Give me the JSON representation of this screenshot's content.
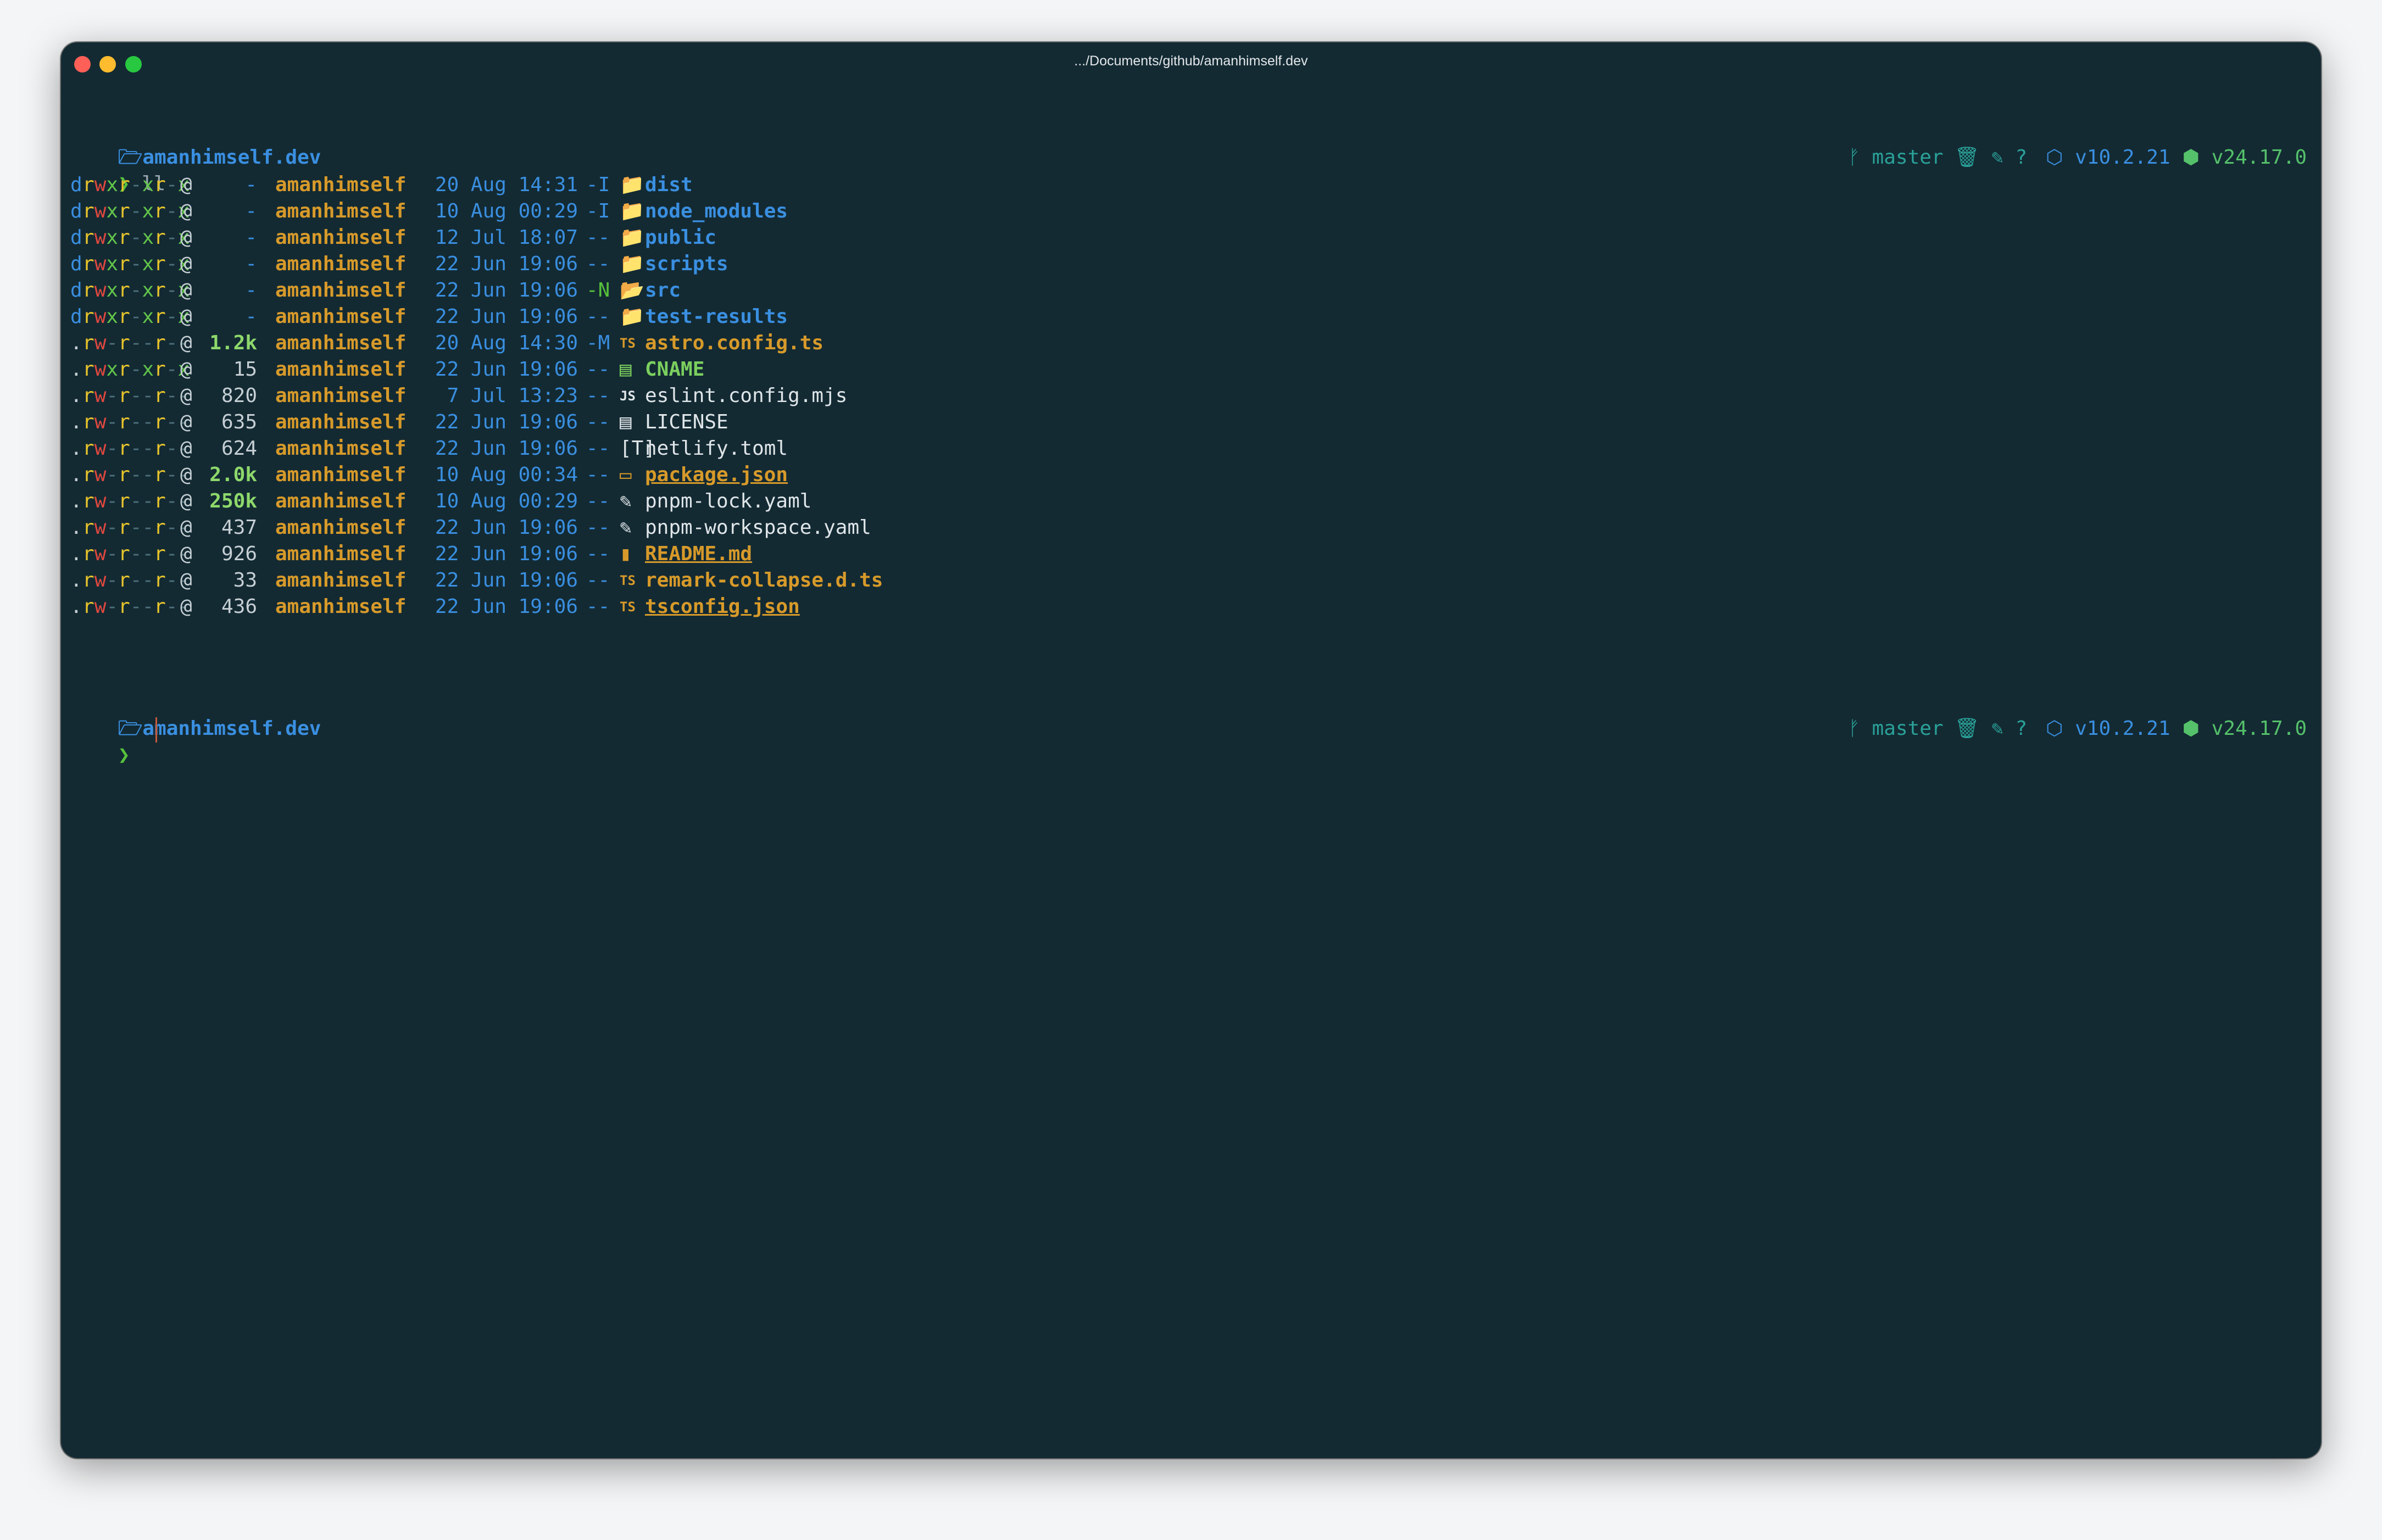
{
  "window": {
    "title": ".../Documents/github/amanhimself.dev"
  },
  "prompt": {
    "folder_icon": "folder-open-icon",
    "directory": "amanhimself.dev",
    "branch_icon": "git-branch-icon",
    "branch": "master",
    "status_icons": "🗑 ✎ ?",
    "package_icon": "package-icon",
    "package_version": "v10.2.21",
    "node_icon": "node-hexagon-icon",
    "node_version": "v24.17.0",
    "char": "❯"
  },
  "command": "ll",
  "listing": [
    {
      "type": "d",
      "perms": "rwxr-xr-x",
      "at": "@",
      "size": "-",
      "user": "amanhimself",
      "date": "20 Aug 14:31",
      "git": "-I",
      "icon": "📁",
      "icon_name": "folder-icon",
      "name": "dist",
      "style": "dir"
    },
    {
      "type": "d",
      "perms": "rwxr-xr-x",
      "at": "@",
      "size": "-",
      "user": "amanhimself",
      "date": "10 Aug 00:29",
      "git": "-I",
      "icon": "📁",
      "icon_name": "folder-icon",
      "name": "node_modules",
      "style": "dir"
    },
    {
      "type": "d",
      "perms": "rwxr-xr-x",
      "at": "@",
      "size": "-",
      "user": "amanhimself",
      "date": "12 Jul 18:07",
      "git": "--",
      "icon": "📁",
      "icon_name": "folder-icon",
      "name": "public",
      "style": "dir"
    },
    {
      "type": "d",
      "perms": "rwxr-xr-x",
      "at": "@",
      "size": "-",
      "user": "amanhimself",
      "date": "22 Jun 19:06",
      "git": "--",
      "icon": "📁",
      "icon_name": "folder-icon",
      "name": "scripts",
      "style": "dir"
    },
    {
      "type": "d",
      "perms": "rwxr-xr-x",
      "at": "@",
      "size": "-",
      "user": "amanhimself",
      "date": "22 Jun 19:06",
      "git": "-N",
      "icon": "📂",
      "icon_name": "folder-src-icon",
      "name": "src",
      "style": "dir"
    },
    {
      "type": "d",
      "perms": "rwxr-xr-x",
      "at": "@",
      "size": "-",
      "user": "amanhimself",
      "date": "22 Jun 19:06",
      "git": "--",
      "icon": "📁",
      "icon_name": "folder-icon",
      "name": "test-results",
      "style": "dir"
    },
    {
      "type": ".",
      "perms": "rw-r--r--",
      "at": "@",
      "size": "1.2k",
      "user": "amanhimself",
      "date": "20 Aug 14:30",
      "git": "-M",
      "icon": "TS",
      "icon_name": "typescript-icon",
      "name": "astro.config.ts",
      "style": "ts"
    },
    {
      "type": ".",
      "perms": "rwxr-xr-x",
      "at": "@",
      "size": "15",
      "user": "amanhimself",
      "date": "22 Jun 19:06",
      "git": "--",
      "icon": "▤",
      "icon_name": "file-icon",
      "name": "CNAME",
      "style": "green"
    },
    {
      "type": ".",
      "perms": "rw-r--r--",
      "at": "@",
      "size": "820",
      "user": "amanhimself",
      "date": "7 Jul 13:23",
      "git": "--",
      "icon": "JS",
      "icon_name": "javascript-icon",
      "name": "eslint.config.mjs",
      "style": "plain"
    },
    {
      "type": ".",
      "perms": "rw-r--r--",
      "at": "@",
      "size": "635",
      "user": "amanhimself",
      "date": "22 Jun 19:06",
      "git": "--",
      "icon": "▤",
      "icon_name": "license-icon",
      "name": "LICENSE",
      "style": "plain"
    },
    {
      "type": ".",
      "perms": "rw-r--r--",
      "at": "@",
      "size": "624",
      "user": "amanhimself",
      "date": "22 Jun 19:06",
      "git": "--",
      "icon": "[T]",
      "icon_name": "toml-icon",
      "name": "netlify.toml",
      "style": "plain"
    },
    {
      "type": ".",
      "perms": "rw-r--r--",
      "at": "@",
      "size": "2.0k",
      "user": "amanhimself",
      "date": "10 Aug 00:34",
      "git": "--",
      "icon": "▭",
      "icon_name": "npm-icon",
      "name": "package.json",
      "style": "ul"
    },
    {
      "type": ".",
      "perms": "rw-r--r--",
      "at": "@",
      "size": "250k",
      "user": "amanhimself",
      "date": "10 Aug 00:29",
      "git": "--",
      "icon": "✎",
      "icon_name": "yaml-icon",
      "name": "pnpm-lock.yaml",
      "style": "plain"
    },
    {
      "type": ".",
      "perms": "rw-r--r--",
      "at": "@",
      "size": "437",
      "user": "amanhimself",
      "date": "22 Jun 19:06",
      "git": "--",
      "icon": "✎",
      "icon_name": "yaml-icon",
      "name": "pnpm-workspace.yaml",
      "style": "plain"
    },
    {
      "type": ".",
      "perms": "rw-r--r--",
      "at": "@",
      "size": "926",
      "user": "amanhimself",
      "date": "22 Jun 19:06",
      "git": "--",
      "icon": "▮",
      "icon_name": "readme-icon",
      "name": "README.md",
      "style": "ul"
    },
    {
      "type": ".",
      "perms": "rw-r--r--",
      "at": "@",
      "size": "33",
      "user": "amanhimself",
      "date": "22 Jun 19:06",
      "git": "--",
      "icon": "TS",
      "icon_name": "typescript-icon",
      "name": "remark-collapse.d.ts",
      "style": "ts"
    },
    {
      "type": ".",
      "perms": "rw-r--r--",
      "at": "@",
      "size": "436",
      "user": "amanhimself",
      "date": "22 Jun 19:06",
      "git": "--",
      "icon": "TS",
      "icon_name": "typescript-icon",
      "name": "tsconfig.json",
      "style": "ul"
    }
  ]
}
